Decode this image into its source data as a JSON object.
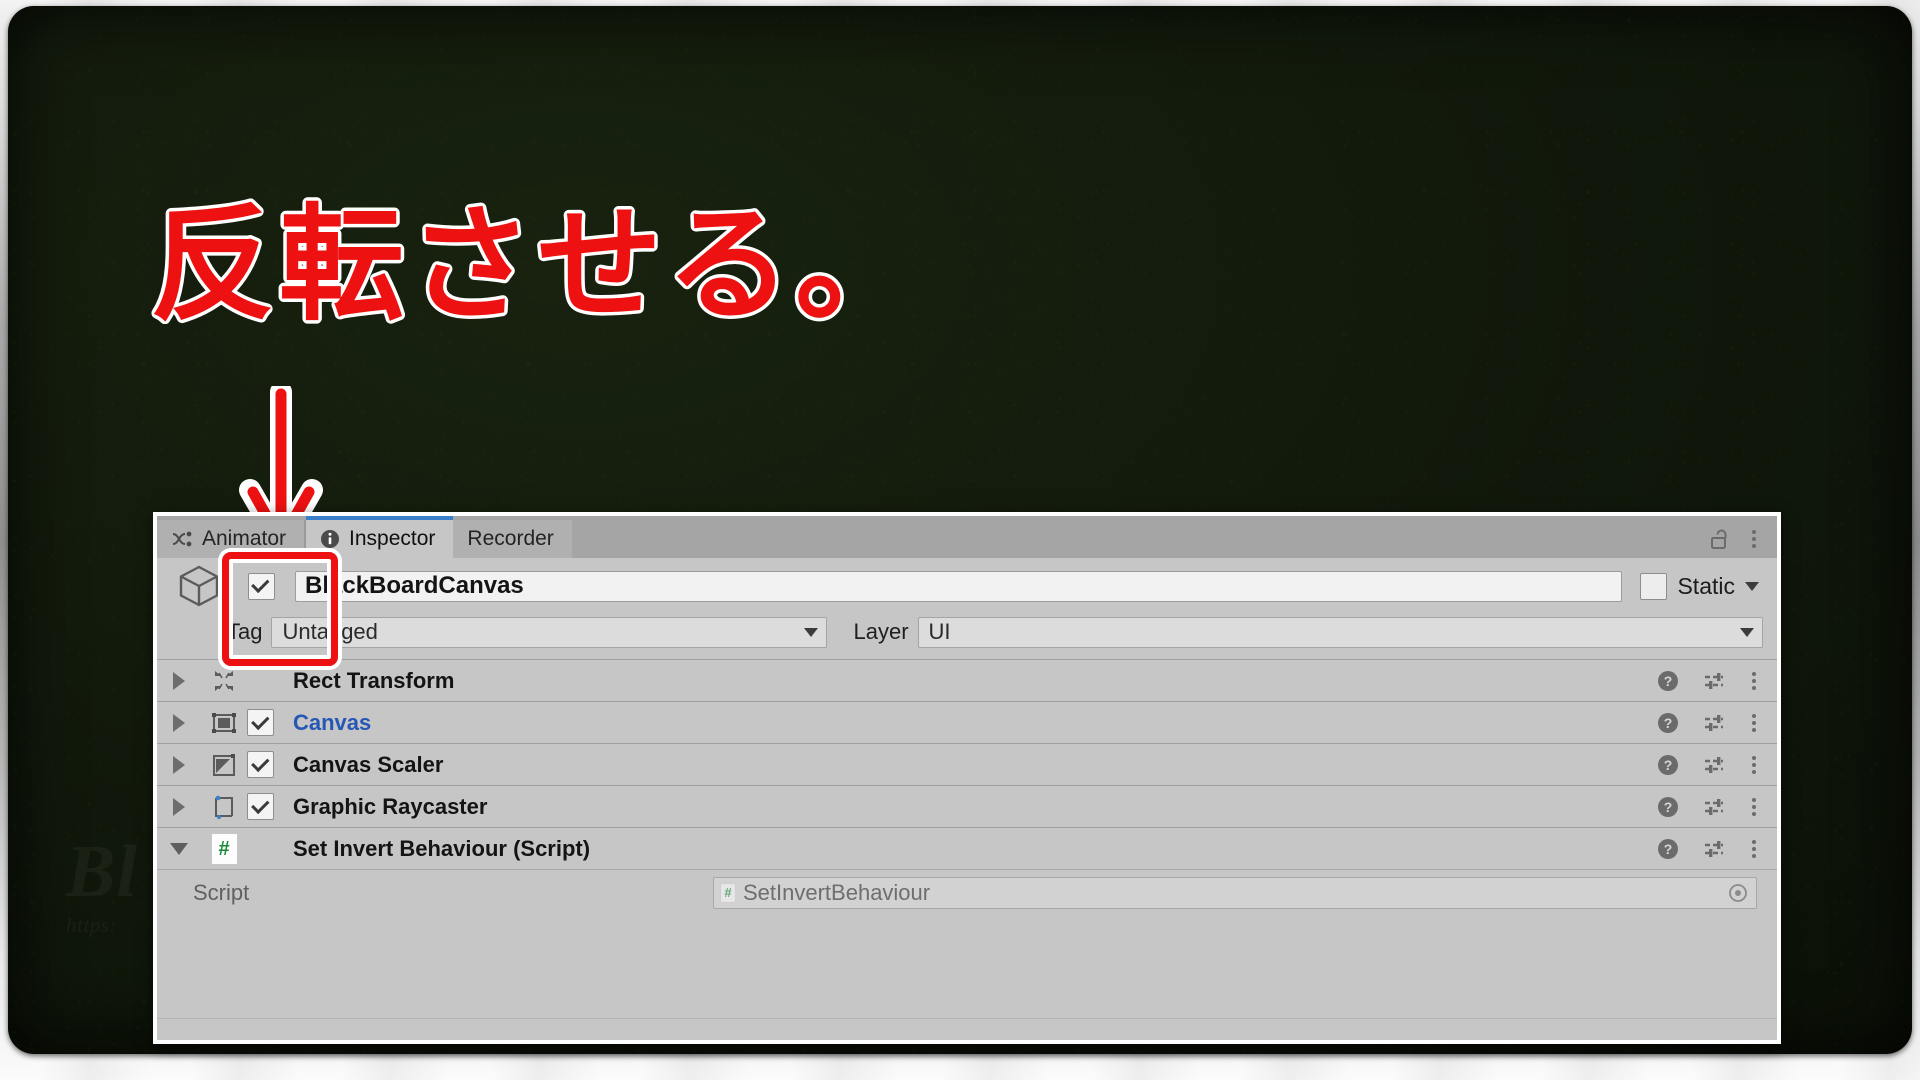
{
  "annotation": {
    "handwriting": "反転させる。",
    "color": "#ee1111"
  },
  "watermark": {
    "line1": "Bl",
    "line2": "https:"
  },
  "inspector": {
    "tabs": [
      {
        "label": "Animator",
        "icon": "animator-icon",
        "active": false
      },
      {
        "label": "Inspector",
        "icon": "info-icon",
        "active": true
      },
      {
        "label": "Recorder",
        "icon": "none",
        "active": false
      }
    ],
    "window_tools": {
      "lock": "lock-open-icon",
      "menu": "kebab-menu-icon"
    },
    "game_object": {
      "icon": "cube-icon",
      "enabled": true,
      "name": "BlackBoardCanvas",
      "static_enabled": false,
      "static_label": "Static",
      "tag_label": "Tag",
      "tag_value": "Untagged",
      "layer_label": "Layer",
      "layer_value": "UI"
    },
    "components": [
      {
        "name": "Rect Transform",
        "icon": "rect-transform-icon",
        "expanded": false,
        "has_toggle": false,
        "enabled": false,
        "link": false
      },
      {
        "name": "Canvas",
        "icon": "canvas-icon",
        "expanded": false,
        "has_toggle": true,
        "enabled": true,
        "link": true
      },
      {
        "name": "Canvas Scaler",
        "icon": "canvas-scaler-icon",
        "expanded": false,
        "has_toggle": true,
        "enabled": true,
        "link": false
      },
      {
        "name": "Graphic Raycaster",
        "icon": "raycaster-icon",
        "expanded": false,
        "has_toggle": true,
        "enabled": true,
        "link": false
      },
      {
        "name": "Set Invert Behaviour (Script)",
        "icon": "script-icon",
        "expanded": true,
        "has_toggle": false,
        "enabled": false,
        "link": false
      }
    ],
    "component_row_tools": {
      "help": "help-icon",
      "preset": "preset-icon",
      "menu": "kebab-menu-icon"
    },
    "script_property": {
      "label": "Script",
      "value": "SetInvertBehaviour",
      "picker": "object-picker-icon"
    }
  }
}
